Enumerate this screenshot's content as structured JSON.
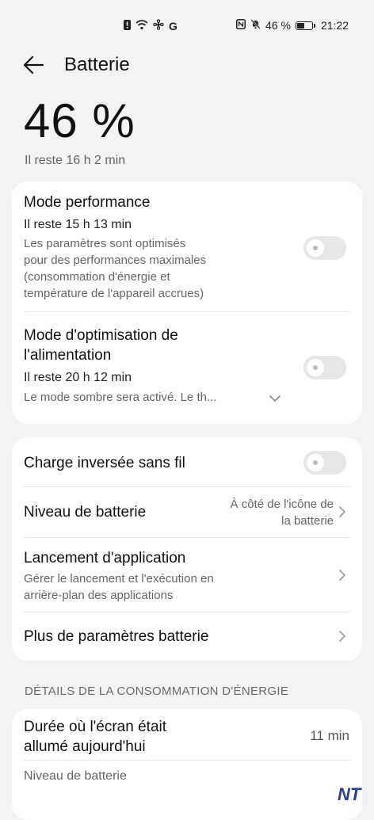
{
  "status_bar": {
    "left_icons": [
      "alert-icon",
      "wifi-icon",
      "fan-icon",
      "G"
    ],
    "nfc": "N",
    "battery_pct": "46 %",
    "battery_level": 0.46,
    "time": "21:22"
  },
  "header": {
    "title": "Batterie"
  },
  "summary": {
    "percent": "46 %",
    "remaining": "Il reste 16 h 2 min"
  },
  "modes": {
    "performance": {
      "title": "Mode performance",
      "remaining": "Il reste 15 h 13 min",
      "desc_lines": [
        "Les paramètres sont optimisés",
        "pour des performances maximales",
        "(consommation d'énergie et",
        "température de l'appareil accrues)"
      ],
      "enabled": false
    },
    "power_saving": {
      "title_lines": [
        "Mode d'optimisation de",
        "l'alimentation"
      ],
      "remaining": "Il reste 20 h 12 min",
      "desc": "Le mode sombre sera activé. Le th...",
      "enabled": false
    }
  },
  "settings": {
    "reverse_charge": {
      "label": "Charge inversée sans fil",
      "enabled": false
    },
    "battery_level": {
      "label": "Niveau de batterie",
      "value_lines": [
        "À côté de l'icône de",
        "la batterie"
      ]
    },
    "app_launch": {
      "label": "Lancement d'application",
      "desc_lines": [
        "Gérer le lancement et l'exécution en",
        "arrière-plan des applications"
      ]
    },
    "more": {
      "label": "Plus de paramètres batterie"
    }
  },
  "details": {
    "section_title": "DÉTAILS DE LA CONSOMMATION D'ÉNERGIE",
    "screen_on": {
      "label_lines": [
        "Durée où l'écran était",
        "allumé aujourd'hui"
      ],
      "value": "11 min"
    },
    "battery_level_label": "Niveau de batterie"
  },
  "watermark": "NT"
}
